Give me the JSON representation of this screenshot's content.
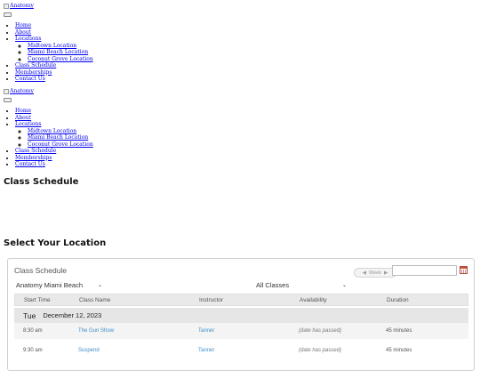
{
  "header1": {
    "logo_alt": "Anatomy",
    "menu": {
      "home": "Home",
      "about": "About",
      "locations": "Locations",
      "locations_sub": [
        "Midtown Location",
        "Miami Beach Location",
        "Coconut Grove Location"
      ],
      "class_schedule": "Class Schedule",
      "memberships": "Memberships",
      "contact": "Contact Us"
    }
  },
  "header2": {
    "logo_alt": "Anatomy",
    "menu": {
      "home": "Home",
      "about": "About",
      "locations": "Locations",
      "locations_sub": [
        "Midtown Location",
        "Miami Beach Location",
        "Coconut Grove Location"
      ],
      "class_schedule": "Class Schedule",
      "memberships": "Memberships",
      "contact": "Contact Us"
    }
  },
  "page_title": "Class Schedule",
  "select_heading": "Select Your Location",
  "widget": {
    "title": "Class Schedule",
    "week_label": "Week",
    "location_selected": "Anatomy Miami Beach",
    "class_filter_selected": "All Classes",
    "date_value": "",
    "columns": [
      "Start Time",
      "Class Name",
      "Instructor",
      "Availability",
      "Duration"
    ],
    "day": {
      "weekday": "Tue",
      "date": "December 12, 2023"
    },
    "rows": [
      {
        "time": "8:30 am",
        "class": "The Gun Show",
        "instructor": "Tanner",
        "availability": "(date has passed)",
        "duration": "45 minutes"
      },
      {
        "time": "9:30 am",
        "class": "Suspend",
        "instructor": "Tanner",
        "availability": "(date has passed)",
        "duration": "45 minutes"
      }
    ]
  },
  "icons": {
    "calendar": "calendar-icon",
    "broken_image": "broken-image-icon",
    "chevron": "chevron-down-icon",
    "menu_toggle": "menu-toggle-icon"
  },
  "colors": {
    "link": "#0000ee",
    "class_link": "#3d8ec9",
    "calendar": "#c9553f",
    "table_header_bg": "#e9e9e9"
  }
}
